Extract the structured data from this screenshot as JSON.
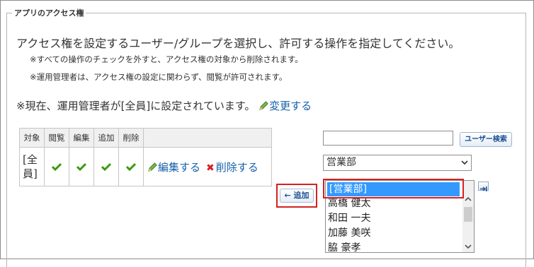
{
  "section": {
    "legend": "アプリのアクセス権",
    "instruction": "アクセス権を設定するユーザー/グループを選択し、許可する操作を指定してください。",
    "note1": "※すべての操作のチェックを外すと、アクセス権の対象から削除されます。",
    "note2": "※運用管理者は、アクセス権の設定に関わらず、閲覧が許可されます。",
    "current_text": "※現在、運用管理者が[全員]に設定されています。",
    "change_link": "変更する"
  },
  "table": {
    "headers": [
      "対象",
      "閲覧",
      "編集",
      "追加",
      "削除"
    ],
    "rows": [
      {
        "target": "[全員]",
        "permissions": [
          true,
          true,
          true,
          true
        ],
        "edit_label": "編集する",
        "delete_label": "削除する"
      }
    ]
  },
  "search": {
    "input_value": "",
    "button_label": "ユーザー検索"
  },
  "group_select": {
    "selected": "営業部"
  },
  "add_button": {
    "label": "← 追加"
  },
  "user_list": {
    "items": [
      "[営業部]",
      "高橋 健太",
      "和田 一夫",
      "加藤 美咲",
      "脇 豪孝"
    ],
    "selected_index": 0
  },
  "colors": {
    "link": "#1560aa",
    "check": "#3a9a12",
    "highlight_border": "#d62020",
    "selection": "#3399ff"
  }
}
